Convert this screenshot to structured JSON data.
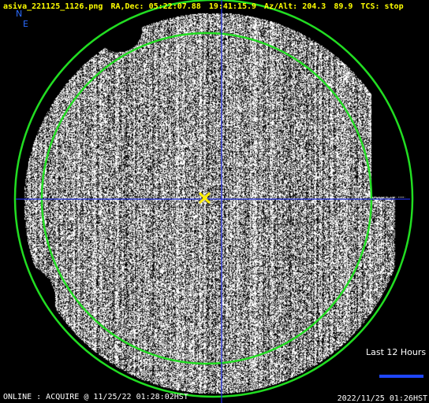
{
  "header": {
    "filename": "asiva_221125_1126.png",
    "radec_label": "RA,Dec:",
    "ra": "05:22:07.88",
    "dec": "19:41:15.9",
    "azalt_label": "Az/Alt:",
    "az": "204.3",
    "alt": "89.9",
    "tcs": "TCS: stop"
  },
  "compass": {
    "north": "N",
    "east": "E"
  },
  "legend": {
    "label": "Last 12 Hours",
    "bar_color": "#1e46ff"
  },
  "footer": {
    "status": "ONLINE : ACQUIRE @ 11/25/22 01:28:02HST",
    "timestamp": "2022/11/25 01:26HST"
  },
  "colors": {
    "header_text": "#ffff00",
    "crosshair": "#1e2bd6",
    "circle": "#22dd22",
    "target_marker": "#ffee00",
    "background": "#000000"
  },
  "icons": {
    "target": "target-x-icon"
  }
}
